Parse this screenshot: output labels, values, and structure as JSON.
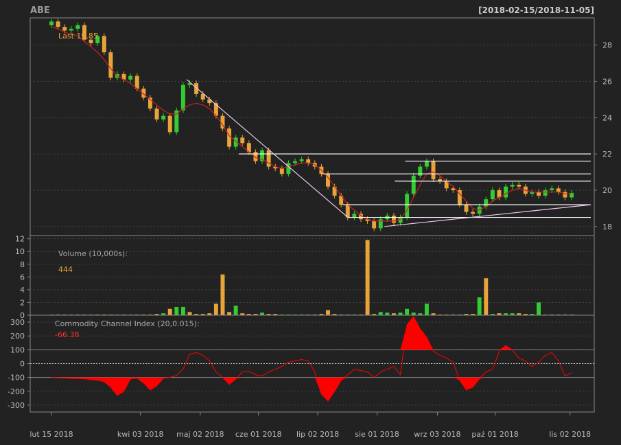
{
  "header": {
    "symbol": "ABE",
    "date_range": "[2018-02-15/2018-11-05]"
  },
  "colors": {
    "background": "#222222",
    "panel_border": "#888888",
    "grid": "#444444",
    "axis_text": "#bbbbbb",
    "label_text": "#aaaaaa",
    "up_candle": "#33cc33",
    "down_candle": "#e8a33a",
    "ma_line": "#cc2222",
    "trend_line": "#f0c8f0",
    "level_line": "#ffffff",
    "cci_fill": "#ff0000",
    "last_value": "#e8a33a",
    "cci_value": "#ff3333"
  },
  "x_axis": {
    "ticks": [
      "lut 15 2018",
      "kwi 03 2018",
      "maj 02 2018",
      "cze 01 2018",
      "lip 02 2018",
      "sie 01 2018",
      "wrz 03 2018",
      "paź 01 2018",
      "lis 02 2018"
    ]
  },
  "chart_data": [
    {
      "type": "candlestick",
      "panel": "price",
      "annotation": "Last 19.85",
      "ylim": [
        17.5,
        29.5
      ],
      "yticks": [
        18,
        20,
        22,
        24,
        26,
        28
      ],
      "grid": true,
      "series": [
        {
          "name": "close",
          "values": [
            29.3,
            29.0,
            28.8,
            28.9,
            29.1,
            28.3,
            28.1,
            28.5,
            27.6,
            26.2,
            26.4,
            26.1,
            26.3,
            25.6,
            25.1,
            24.5,
            23.9,
            24.1,
            23.2,
            24.4,
            25.8,
            25.9,
            25.3,
            25.0,
            24.8,
            24.1,
            23.4,
            22.4,
            22.9,
            22.6,
            22.1,
            21.6,
            22.2,
            21.3,
            21.2,
            20.9,
            21.5,
            21.6,
            21.7,
            21.5,
            21.3,
            20.9,
            20.2,
            19.7,
            19.2,
            18.5,
            18.7,
            18.4,
            18.3,
            17.9,
            18.4,
            18.6,
            18.2,
            18.5,
            19.8,
            20.8,
            21.3,
            21.6,
            20.6,
            20.5,
            20.1,
            20.0,
            19.2,
            18.8,
            18.7,
            19.1,
            19.5,
            20.0,
            19.6,
            20.2,
            20.3,
            20.2,
            19.8,
            19.9,
            19.7,
            20.0,
            20.1,
            19.9,
            19.6,
            19.85
          ]
        }
      ],
      "sma": {
        "values": [
          29.0,
          28.9,
          28.7,
          28.6,
          28.5,
          28.2,
          27.9,
          27.6,
          27.2,
          26.7,
          26.3,
          26.1,
          25.9,
          25.6,
          25.3,
          25.0,
          24.7,
          24.4,
          24.2,
          24.2,
          24.5,
          24.7,
          24.8,
          24.7,
          24.5,
          24.1,
          23.6,
          23.0,
          22.7,
          22.4,
          22.1,
          21.8,
          21.7,
          21.5,
          21.3,
          21.2,
          21.3,
          21.4,
          21.5,
          21.5,
          21.4,
          21.1,
          20.7,
          20.2,
          19.7,
          19.2,
          18.9,
          18.6,
          18.4,
          18.3,
          18.3,
          18.3,
          18.3,
          18.4,
          18.9,
          19.6,
          20.3,
          20.9,
          21.0,
          20.8,
          20.5,
          20.2,
          19.8,
          19.4,
          19.0,
          18.9,
          19.1,
          19.4,
          19.6,
          19.8,
          20.0,
          20.1,
          20.0,
          19.9,
          19.9,
          19.9,
          19.9,
          19.9,
          19.8,
          19.8
        ]
      },
      "trend_lines": [
        {
          "from": [
            0.26,
            26.1
          ],
          "to": [
            0.57,
            18.5
          ]
        },
        {
          "from": [
            0.64,
            18.0
          ],
          "to": [
            1.07,
            19.2
          ]
        }
      ],
      "levels": [
        {
          "value": 22.0,
          "from": 0.36,
          "to": 1.07
        },
        {
          "value": 21.6,
          "from": 0.68,
          "to": 1.07
        },
        {
          "value": 20.9,
          "from": 0.52,
          "to": 1.07
        },
        {
          "value": 20.5,
          "from": 0.66,
          "to": 1.07
        },
        {
          "value": 19.2,
          "from": 0.56,
          "to": 1.07
        },
        {
          "value": 18.5,
          "from": 0.57,
          "to": 1.07
        }
      ]
    },
    {
      "type": "bar",
      "panel": "volume",
      "title": "Volume (10,000s):",
      "last_value": "444",
      "ylim": [
        0,
        12.5
      ],
      "yticks": [
        0,
        2,
        4,
        6,
        8,
        10,
        12
      ],
      "values": [
        0.1,
        0.1,
        0.1,
        0.1,
        0.1,
        0.1,
        0.1,
        0.1,
        0.1,
        0.1,
        0.1,
        0.1,
        0.1,
        0.1,
        0.1,
        0.1,
        0.2,
        0.3,
        1.0,
        1.3,
        1.3,
        0.5,
        0.2,
        0.2,
        0.3,
        1.8,
        6.4,
        0.5,
        1.5,
        0.3,
        0.2,
        0.2,
        0.4,
        0.2,
        0.2,
        0.1,
        0.1,
        0.1,
        0.1,
        0.1,
        0.1,
        0.2,
        0.8,
        0.2,
        0.1,
        0.1,
        0.1,
        0.1,
        11.8,
        0.2,
        0.5,
        0.4,
        0.3,
        0.4,
        1.0,
        0.4,
        0.3,
        1.8,
        0.3,
        0.1,
        0.1,
        0.1,
        0.1,
        0.2,
        0.2,
        2.8,
        5.8,
        0.2,
        0.3,
        0.3,
        0.3,
        0.3,
        0.2,
        0.2,
        2.0,
        0.1,
        0.1,
        0.1,
        0.1,
        0.1
      ],
      "up": [
        1,
        0,
        0,
        1,
        0,
        0,
        1,
        0,
        0,
        0,
        1,
        0,
        1,
        0,
        0,
        0,
        0,
        1,
        0,
        1,
        1,
        0,
        0,
        0,
        0,
        0,
        0,
        0,
        1,
        0,
        0,
        0,
        1,
        0,
        0,
        1,
        1,
        1,
        1,
        0,
        0,
        0,
        0,
        0,
        0,
        0,
        1,
        0,
        0,
        0,
        1,
        1,
        0,
        1,
        1,
        1,
        1,
        1,
        0,
        0,
        0,
        0,
        0,
        0,
        0,
        1,
        0,
        1,
        0,
        1,
        1,
        0,
        0,
        1,
        1,
        1,
        0,
        0,
        0,
        0
      ]
    },
    {
      "type": "area",
      "panel": "cci",
      "title": "Commodity Channel Index (20,0.015):",
      "last_value": "-66.38",
      "ylim": [
        -350,
        350
      ],
      "yticks": [
        -300,
        -200,
        -100,
        0,
        100,
        200,
        300
      ],
      "reference_lines": [
        100,
        0,
        -100
      ],
      "values": [
        -100,
        -103,
        -105,
        -107,
        -108,
        -110,
        -115,
        -120,
        -130,
        -170,
        -230,
        -200,
        -110,
        -105,
        -140,
        -190,
        -160,
        -105,
        -100,
        -85,
        -40,
        70,
        80,
        60,
        20,
        -60,
        -100,
        -150,
        -110,
        -60,
        -55,
        -80,
        -90,
        -60,
        -40,
        -20,
        10,
        20,
        30,
        20,
        -60,
        -220,
        -270,
        -200,
        -120,
        -80,
        -40,
        -50,
        -60,
        -100,
        -60,
        -40,
        -20,
        -80,
        280,
        340,
        250,
        190,
        90,
        60,
        40,
        10,
        -120,
        -190,
        -170,
        -110,
        -60,
        -40,
        90,
        130,
        100,
        40,
        20,
        -20,
        10,
        60,
        80,
        20,
        -90,
        -66
      ]
    }
  ]
}
